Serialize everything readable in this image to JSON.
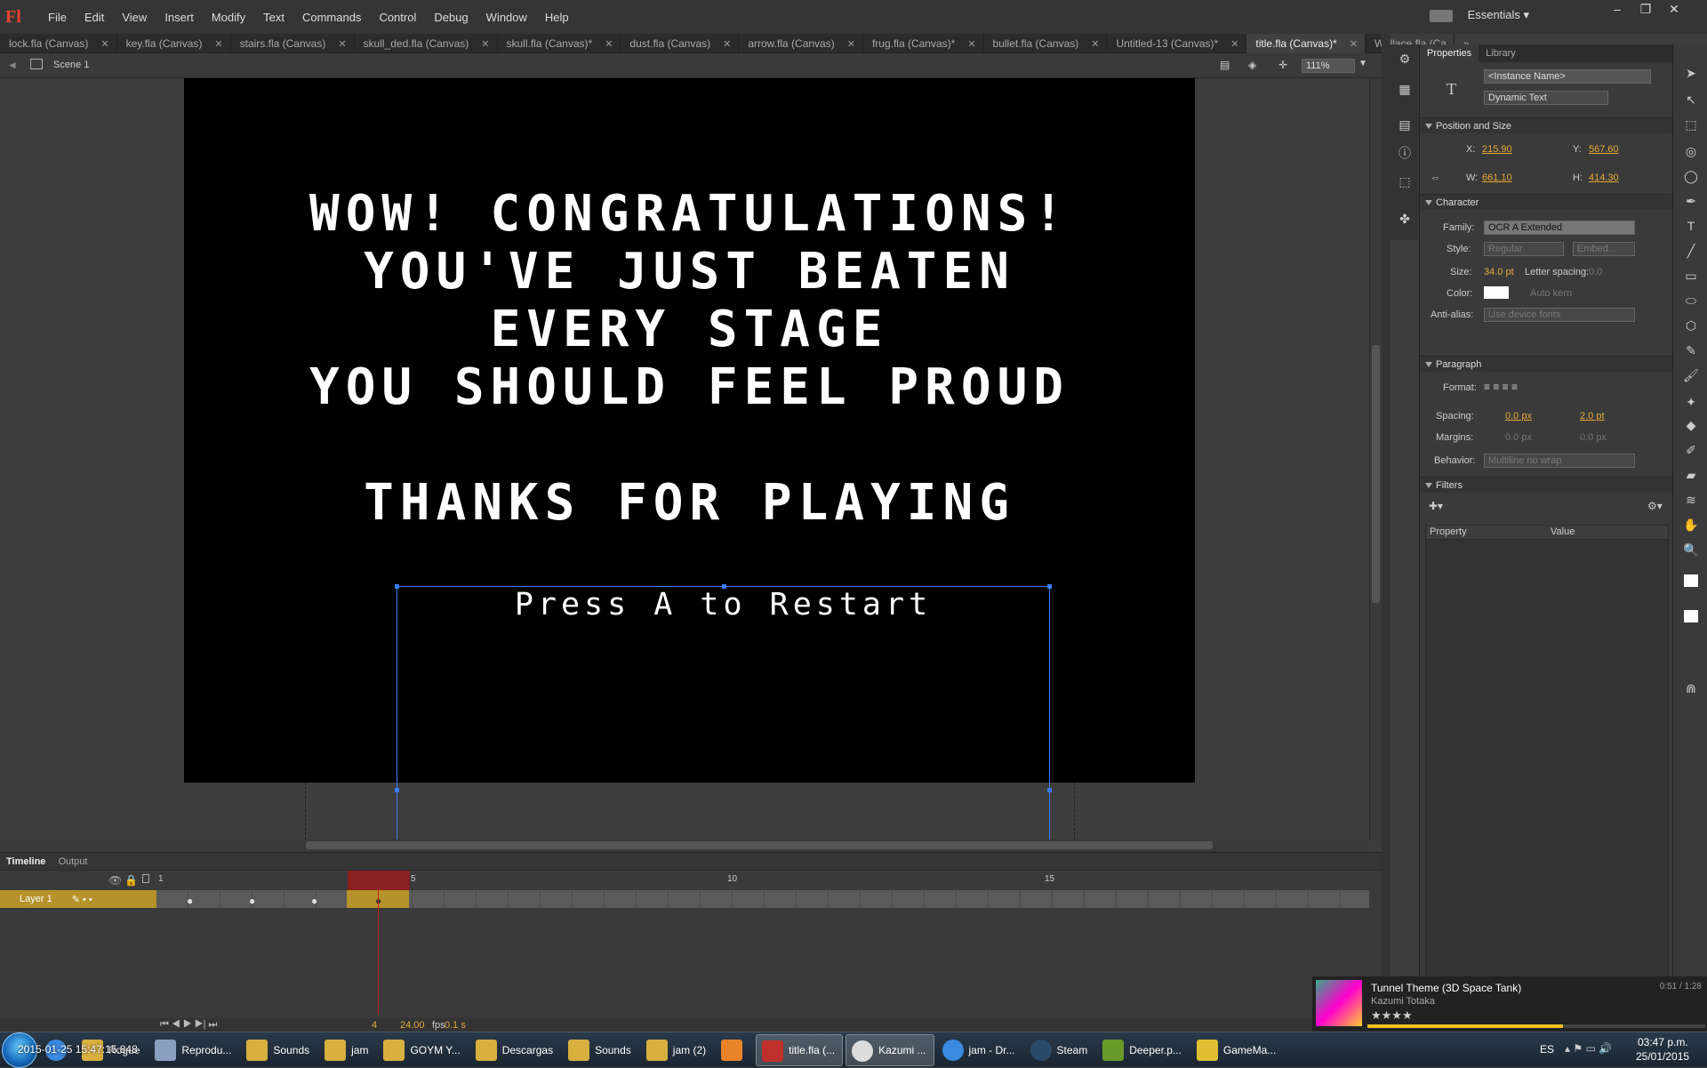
{
  "menubar": {
    "logo": "Fl",
    "items": [
      "File",
      "Edit",
      "View",
      "Insert",
      "Modify",
      "Text",
      "Commands",
      "Control",
      "Debug",
      "Window",
      "Help"
    ],
    "workspace": "Essentials"
  },
  "doc_tabs": [
    {
      "label": "lock.fla (Canvas)",
      "active": false
    },
    {
      "label": "key.fla (Canvas)",
      "active": false
    },
    {
      "label": "stairs.fla (Canvas)",
      "active": false
    },
    {
      "label": "skull_ded.fla (Canvas)",
      "active": false
    },
    {
      "label": "skull.fla (Canvas)*",
      "active": false
    },
    {
      "label": "dust.fla (Canvas)",
      "active": false
    },
    {
      "label": "arrow.fla (Canvas)",
      "active": false
    },
    {
      "label": "frug.fla (Canvas)*",
      "active": false
    },
    {
      "label": "bullet.fla (Canvas)",
      "active": false
    },
    {
      "label": "Untitled-13 (Canvas)*",
      "active": false
    },
    {
      "label": "title.fla (Canvas)*",
      "active": true
    },
    {
      "label": "Wallace.fla (Ca",
      "active": false
    }
  ],
  "editbar": {
    "scene": "Scene 1",
    "zoom": "111%"
  },
  "stage": {
    "lines": [
      "WOW! CONGRATULATIONS!",
      "YOU'VE JUST BEATEN",
      "EVERY STAGE",
      "YOU SHOULD FEEL PROUD"
    ],
    "thanks": "THANKS FOR PLAYING",
    "restart": "Press A to Restart"
  },
  "timeline": {
    "tabs": [
      "Timeline",
      "Output"
    ],
    "ruler": [
      "1",
      "5",
      "10",
      "15"
    ],
    "layer": "Layer 1",
    "current_frame": "4",
    "fps": "24.00",
    "fps_unit": "fps",
    "time": "0.1 s"
  },
  "properties": {
    "tabs": [
      "Properties",
      "Library"
    ],
    "instance_name": "<Instance Name>",
    "text_type": "Dynamic Text",
    "pos_section": "Position and Size",
    "x_label": "X:",
    "x": "215.90",
    "y_label": "Y:",
    "y": "567.60",
    "w_label": "W:",
    "w": "661.10",
    "h_label": "H:",
    "h": "414.30",
    "char_section": "Character",
    "family_label": "Family:",
    "family": "OCR A Extended",
    "style_label": "Style:",
    "style": "Regular",
    "embed": "Embed...",
    "size_label": "Size:",
    "size": "34.0 pt",
    "letter_spacing_label": "Letter spacing:",
    "letter_spacing": "0.0",
    "color_label": "Color:",
    "auto_kern": "Auto kern",
    "anti_alias_label": "Anti-alias:",
    "anti_alias": "Use device fonts",
    "para_section": "Paragraph",
    "format_label": "Format:",
    "spacing_label": "Spacing:",
    "spacing_indent": "0.0 px",
    "spacing_line": "2.0 pt",
    "margins_label": "Margins:",
    "margin_left": "0.0 px",
    "margin_right": "0.0 px",
    "behavior_label": "Behavior:",
    "behavior": "Multiline no wrap",
    "filters_section": "Filters",
    "col_property": "Property",
    "col_value": "Value"
  },
  "music": {
    "title": "Tunnel Theme (3D Space Tank)",
    "artist": "Kazumi Totaka",
    "time": "0:51 / 1:28",
    "rating": "★★★★"
  },
  "taskbar": {
    "items": [
      {
        "label": "Rogue",
        "color": "#d8b040"
      },
      {
        "label": "Reprodu...",
        "color": "#8aa0c0"
      },
      {
        "label": "Sounds",
        "color": "#d8b040"
      },
      {
        "label": "jam",
        "color": "#d8b040"
      },
      {
        "label": "GOYM Y...",
        "color": "#d8b040"
      },
      {
        "label": "Descargas",
        "color": "#d8b040"
      },
      {
        "label": "Sounds",
        "color": "#d8b040"
      },
      {
        "label": "jam (2)",
        "color": "#d8b040"
      },
      {
        "label": "",
        "color": "#e8832a"
      },
      {
        "label": "title.fla (...",
        "color": "#c0302a"
      },
      {
        "label": "Kazumi ...",
        "color": "#dddddd"
      },
      {
        "label": "jam - Dr...",
        "color": "#3a8ae0"
      },
      {
        "label": "Steam",
        "color": "#2a4a6a"
      },
      {
        "label": "Deeper.p...",
        "color": "#6a9a2a"
      },
      {
        "label": "GameMa...",
        "color": "#e0c030"
      }
    ],
    "overlay_text": "2015-01-25 15:47:15.848",
    "lang": "ES",
    "clock_time": "03:47 p.m.",
    "clock_date": "25/01/2015"
  }
}
